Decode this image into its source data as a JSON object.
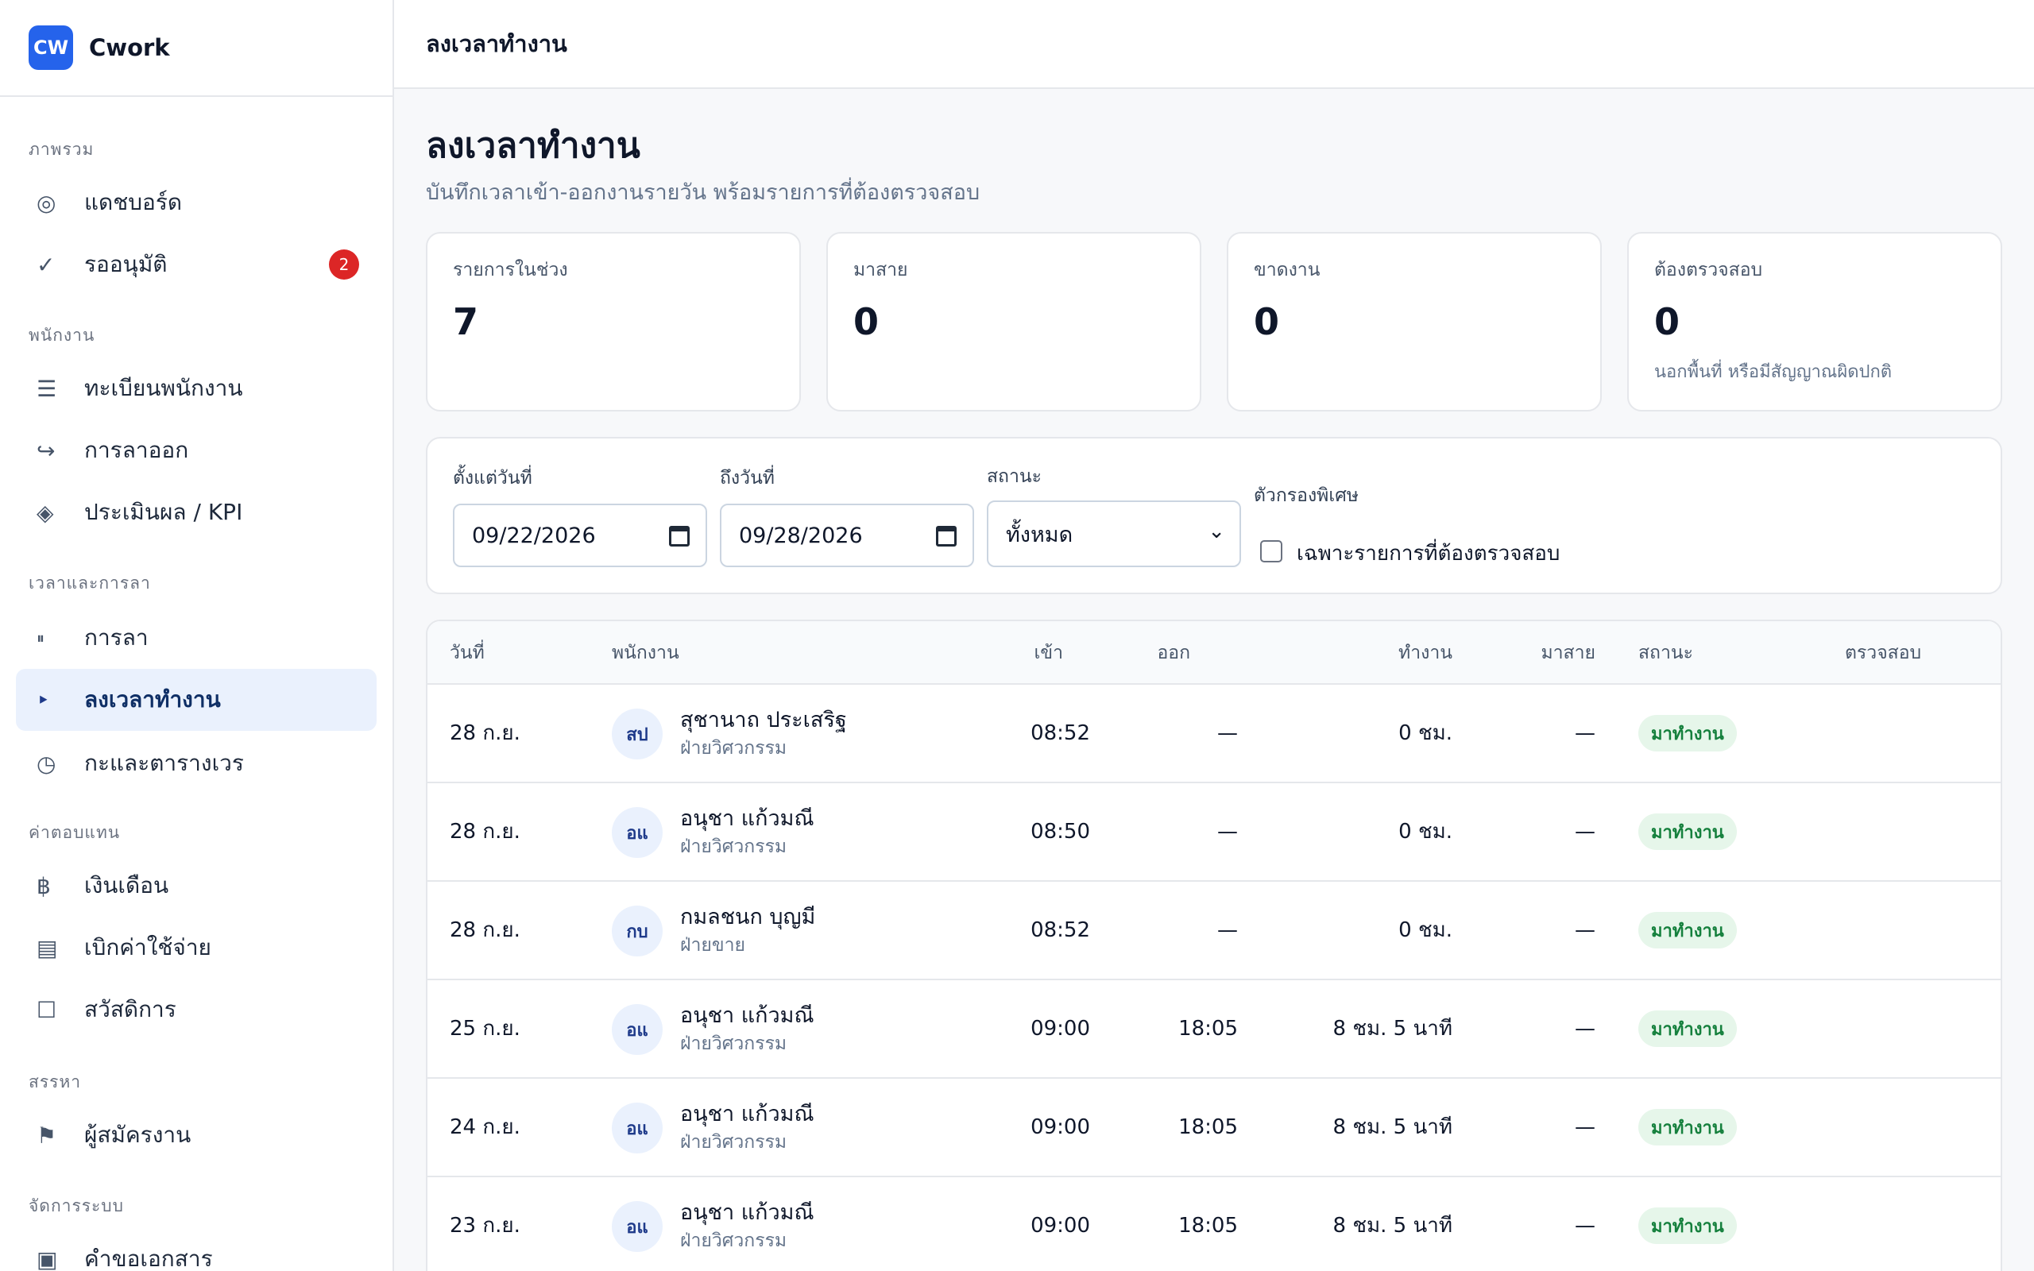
{
  "brand": {
    "logo": "CW",
    "name": "Cwork"
  },
  "sidebar": {
    "groups": [
      {
        "label": "ภาพรวม"
      },
      {
        "label": "พนักงาน"
      },
      {
        "label": "เวลาและการลา"
      },
      {
        "label": "ค่าตอบแทน"
      },
      {
        "label": "สรรหา"
      },
      {
        "label": "จัดการระบบ"
      }
    ],
    "items": [
      {
        "label": "แดชบอร์ด",
        "icon": "◎",
        "icon_name": "dashboard-icon"
      },
      {
        "label": "รออนุมัติ",
        "icon": "✓",
        "icon_name": "check-icon",
        "badge": "2"
      },
      {
        "label": "ทะเบียนพนักงาน",
        "icon": "☰",
        "icon_name": "list-icon"
      },
      {
        "label": "การลาออก",
        "icon": "↪",
        "icon_name": "exit-arrow-icon"
      },
      {
        "label": "ประเมินผล / KPI",
        "icon": "◈",
        "icon_name": "diamond-icon"
      },
      {
        "label": "การลา",
        "icon": "⏸",
        "icon_name": "pause-icon"
      },
      {
        "label": "ลงเวลาทำงาน",
        "icon": "‣",
        "icon_name": "play-icon",
        "active": true
      },
      {
        "label": "กะและตารางเวร",
        "icon": "◷",
        "icon_name": "clock-icon"
      },
      {
        "label": "เงินเดือน",
        "icon": "฿",
        "icon_name": "baht-icon"
      },
      {
        "label": "เบิกค่าใช้จ่าย",
        "icon": "▤",
        "icon_name": "receipt-icon"
      },
      {
        "label": "สวัสดิการ",
        "icon": "☐",
        "icon_name": "square-icon"
      },
      {
        "label": "ผู้สมัครงาน",
        "icon": "⚑",
        "icon_name": "flag-icon"
      },
      {
        "label": "คำขอเอกสาร",
        "icon": "▣",
        "icon_name": "document-icon"
      }
    ]
  },
  "topbar": {
    "title": "ลงเวลาทำงาน"
  },
  "page": {
    "title": "ลงเวลาทำงาน",
    "subtitle": "บันทึกเวลาเข้า-ออกงานรายวัน พร้อมรายการที่ต้องตรวจสอบ"
  },
  "stats": [
    {
      "label": "รายการในช่วง",
      "value": "7",
      "note": ""
    },
    {
      "label": "มาสาย",
      "value": "0",
      "note": ""
    },
    {
      "label": "ขาดงาน",
      "value": "0",
      "note": ""
    },
    {
      "label": "ต้องตรวจสอบ",
      "value": "0",
      "note": "นอกพื้นที่ หรือมีสัญญาณผิดปกติ"
    }
  ],
  "filters": {
    "from_label": "ตั้งแต่วันที่",
    "from_value": "09/22/2026",
    "to_label": "ถึงวันที่",
    "to_value": "09/28/2026",
    "status_label": "สถานะ",
    "status_value": "ทั้งหมด",
    "special_label": "ตัวกรองพิเศษ",
    "special_checkbox_label": "เฉพาะรายการที่ต้องตรวจสอบ"
  },
  "table": {
    "columns": {
      "date": "วันที่",
      "employee": "พนักงาน",
      "in": "เข้า",
      "out": "ออก",
      "worked": "ทำงาน",
      "late": "มาสาย",
      "status": "สถานะ",
      "review": "ตรวจสอบ"
    },
    "rows": [
      {
        "date": "28 ก.ย.",
        "initials": "สป",
        "name": "สุชานาถ ประเสริฐ",
        "dept": "ฝ่ายวิศวกรรม",
        "in": "08:52",
        "out": "—",
        "worked": "0 ชม.",
        "late": "—",
        "status": "มาทำงาน"
      },
      {
        "date": "28 ก.ย.",
        "initials": "อแ",
        "name": "อนุชา แก้วมณี",
        "dept": "ฝ่ายวิศวกรรม",
        "in": "08:50",
        "out": "—",
        "worked": "0 ชม.",
        "late": "—",
        "status": "มาทำงาน"
      },
      {
        "date": "28 ก.ย.",
        "initials": "กบ",
        "name": "กมลชนก บุญมี",
        "dept": "ฝ่ายขาย",
        "in": "08:52",
        "out": "—",
        "worked": "0 ชม.",
        "late": "—",
        "status": "มาทำงาน"
      },
      {
        "date": "25 ก.ย.",
        "initials": "อแ",
        "name": "อนุชา แก้วมณี",
        "dept": "ฝ่ายวิศวกรรม",
        "in": "09:00",
        "out": "18:05",
        "worked": "8 ชม. 5 นาที",
        "late": "—",
        "status": "มาทำงาน"
      },
      {
        "date": "24 ก.ย.",
        "initials": "อแ",
        "name": "อนุชา แก้วมณี",
        "dept": "ฝ่ายวิศวกรรม",
        "in": "09:00",
        "out": "18:05",
        "worked": "8 ชม. 5 นาที",
        "late": "—",
        "status": "มาทำงาน"
      },
      {
        "date": "23 ก.ย.",
        "initials": "อแ",
        "name": "อนุชา แก้วมณี",
        "dept": "ฝ่ายวิศวกรรม",
        "in": "09:00",
        "out": "18:05",
        "worked": "8 ชม. 5 นาที",
        "late": "—",
        "status": "มาทำงาน"
      }
    ]
  },
  "colors": {
    "accent": "#2563eb",
    "active_bg": "#eaf1fd",
    "badge_red": "#dc2626",
    "status_green": "#15803d"
  }
}
